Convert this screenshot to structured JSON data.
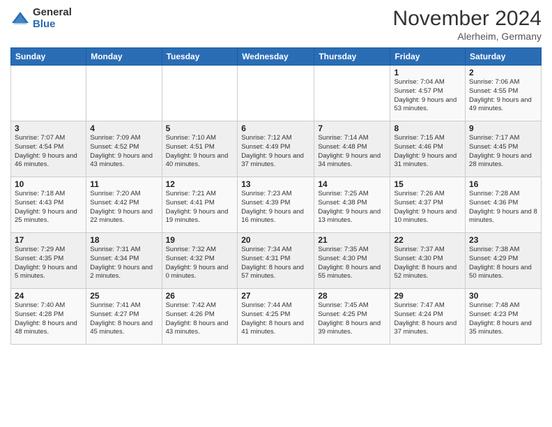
{
  "logo": {
    "general": "General",
    "blue": "Blue"
  },
  "header": {
    "month": "November 2024",
    "location": "Alerheim, Germany"
  },
  "weekdays": [
    "Sunday",
    "Monday",
    "Tuesday",
    "Wednesday",
    "Thursday",
    "Friday",
    "Saturday"
  ],
  "weeks": [
    [
      {
        "day": "",
        "sunrise": "",
        "sunset": "",
        "daylight": ""
      },
      {
        "day": "",
        "sunrise": "",
        "sunset": "",
        "daylight": ""
      },
      {
        "day": "",
        "sunrise": "",
        "sunset": "",
        "daylight": ""
      },
      {
        "day": "",
        "sunrise": "",
        "sunset": "",
        "daylight": ""
      },
      {
        "day": "",
        "sunrise": "",
        "sunset": "",
        "daylight": ""
      },
      {
        "day": "1",
        "sunrise": "Sunrise: 7:04 AM",
        "sunset": "Sunset: 4:57 PM",
        "daylight": "Daylight: 9 hours and 53 minutes."
      },
      {
        "day": "2",
        "sunrise": "Sunrise: 7:06 AM",
        "sunset": "Sunset: 4:55 PM",
        "daylight": "Daylight: 9 hours and 49 minutes."
      }
    ],
    [
      {
        "day": "3",
        "sunrise": "Sunrise: 7:07 AM",
        "sunset": "Sunset: 4:54 PM",
        "daylight": "Daylight: 9 hours and 46 minutes."
      },
      {
        "day": "4",
        "sunrise": "Sunrise: 7:09 AM",
        "sunset": "Sunset: 4:52 PM",
        "daylight": "Daylight: 9 hours and 43 minutes."
      },
      {
        "day": "5",
        "sunrise": "Sunrise: 7:10 AM",
        "sunset": "Sunset: 4:51 PM",
        "daylight": "Daylight: 9 hours and 40 minutes."
      },
      {
        "day": "6",
        "sunrise": "Sunrise: 7:12 AM",
        "sunset": "Sunset: 4:49 PM",
        "daylight": "Daylight: 9 hours and 37 minutes."
      },
      {
        "day": "7",
        "sunrise": "Sunrise: 7:14 AM",
        "sunset": "Sunset: 4:48 PM",
        "daylight": "Daylight: 9 hours and 34 minutes."
      },
      {
        "day": "8",
        "sunrise": "Sunrise: 7:15 AM",
        "sunset": "Sunset: 4:46 PM",
        "daylight": "Daylight: 9 hours and 31 minutes."
      },
      {
        "day": "9",
        "sunrise": "Sunrise: 7:17 AM",
        "sunset": "Sunset: 4:45 PM",
        "daylight": "Daylight: 9 hours and 28 minutes."
      }
    ],
    [
      {
        "day": "10",
        "sunrise": "Sunrise: 7:18 AM",
        "sunset": "Sunset: 4:43 PM",
        "daylight": "Daylight: 9 hours and 25 minutes."
      },
      {
        "day": "11",
        "sunrise": "Sunrise: 7:20 AM",
        "sunset": "Sunset: 4:42 PM",
        "daylight": "Daylight: 9 hours and 22 minutes."
      },
      {
        "day": "12",
        "sunrise": "Sunrise: 7:21 AM",
        "sunset": "Sunset: 4:41 PM",
        "daylight": "Daylight: 9 hours and 19 minutes."
      },
      {
        "day": "13",
        "sunrise": "Sunrise: 7:23 AM",
        "sunset": "Sunset: 4:39 PM",
        "daylight": "Daylight: 9 hours and 16 minutes."
      },
      {
        "day": "14",
        "sunrise": "Sunrise: 7:25 AM",
        "sunset": "Sunset: 4:38 PM",
        "daylight": "Daylight: 9 hours and 13 minutes."
      },
      {
        "day": "15",
        "sunrise": "Sunrise: 7:26 AM",
        "sunset": "Sunset: 4:37 PM",
        "daylight": "Daylight: 9 hours and 10 minutes."
      },
      {
        "day": "16",
        "sunrise": "Sunrise: 7:28 AM",
        "sunset": "Sunset: 4:36 PM",
        "daylight": "Daylight: 9 hours and 8 minutes."
      }
    ],
    [
      {
        "day": "17",
        "sunrise": "Sunrise: 7:29 AM",
        "sunset": "Sunset: 4:35 PM",
        "daylight": "Daylight: 9 hours and 5 minutes."
      },
      {
        "day": "18",
        "sunrise": "Sunrise: 7:31 AM",
        "sunset": "Sunset: 4:34 PM",
        "daylight": "Daylight: 9 hours and 2 minutes."
      },
      {
        "day": "19",
        "sunrise": "Sunrise: 7:32 AM",
        "sunset": "Sunset: 4:32 PM",
        "daylight": "Daylight: 9 hours and 0 minutes."
      },
      {
        "day": "20",
        "sunrise": "Sunrise: 7:34 AM",
        "sunset": "Sunset: 4:31 PM",
        "daylight": "Daylight: 8 hours and 57 minutes."
      },
      {
        "day": "21",
        "sunrise": "Sunrise: 7:35 AM",
        "sunset": "Sunset: 4:30 PM",
        "daylight": "Daylight: 8 hours and 55 minutes."
      },
      {
        "day": "22",
        "sunrise": "Sunrise: 7:37 AM",
        "sunset": "Sunset: 4:30 PM",
        "daylight": "Daylight: 8 hours and 52 minutes."
      },
      {
        "day": "23",
        "sunrise": "Sunrise: 7:38 AM",
        "sunset": "Sunset: 4:29 PM",
        "daylight": "Daylight: 8 hours and 50 minutes."
      }
    ],
    [
      {
        "day": "24",
        "sunrise": "Sunrise: 7:40 AM",
        "sunset": "Sunset: 4:28 PM",
        "daylight": "Daylight: 8 hours and 48 minutes."
      },
      {
        "day": "25",
        "sunrise": "Sunrise: 7:41 AM",
        "sunset": "Sunset: 4:27 PM",
        "daylight": "Daylight: 8 hours and 45 minutes."
      },
      {
        "day": "26",
        "sunrise": "Sunrise: 7:42 AM",
        "sunset": "Sunset: 4:26 PM",
        "daylight": "Daylight: 8 hours and 43 minutes."
      },
      {
        "day": "27",
        "sunrise": "Sunrise: 7:44 AM",
        "sunset": "Sunset: 4:25 PM",
        "daylight": "Daylight: 8 hours and 41 minutes."
      },
      {
        "day": "28",
        "sunrise": "Sunrise: 7:45 AM",
        "sunset": "Sunset: 4:25 PM",
        "daylight": "Daylight: 8 hours and 39 minutes."
      },
      {
        "day": "29",
        "sunrise": "Sunrise: 7:47 AM",
        "sunset": "Sunset: 4:24 PM",
        "daylight": "Daylight: 8 hours and 37 minutes."
      },
      {
        "day": "30",
        "sunrise": "Sunrise: 7:48 AM",
        "sunset": "Sunset: 4:23 PM",
        "daylight": "Daylight: 8 hours and 35 minutes."
      }
    ]
  ]
}
